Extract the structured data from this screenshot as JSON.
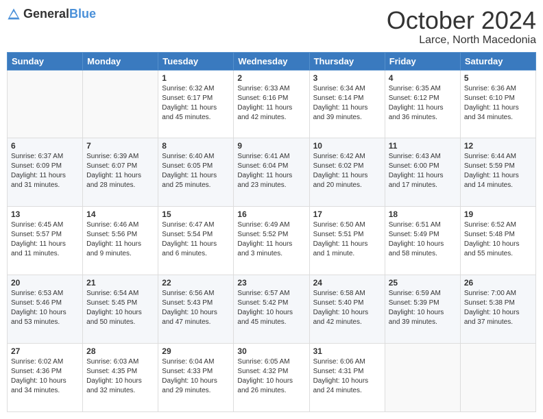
{
  "logo": {
    "general": "General",
    "blue": "Blue"
  },
  "header": {
    "month": "October 2024",
    "location": "Larce, North Macedonia"
  },
  "days_of_week": [
    "Sunday",
    "Monday",
    "Tuesday",
    "Wednesday",
    "Thursday",
    "Friday",
    "Saturday"
  ],
  "weeks": [
    [
      {
        "day": "",
        "info": ""
      },
      {
        "day": "",
        "info": ""
      },
      {
        "day": "1",
        "info": "Sunrise: 6:32 AM\nSunset: 6:17 PM\nDaylight: 11 hours and 45 minutes."
      },
      {
        "day": "2",
        "info": "Sunrise: 6:33 AM\nSunset: 6:16 PM\nDaylight: 11 hours and 42 minutes."
      },
      {
        "day": "3",
        "info": "Sunrise: 6:34 AM\nSunset: 6:14 PM\nDaylight: 11 hours and 39 minutes."
      },
      {
        "day": "4",
        "info": "Sunrise: 6:35 AM\nSunset: 6:12 PM\nDaylight: 11 hours and 36 minutes."
      },
      {
        "day": "5",
        "info": "Sunrise: 6:36 AM\nSunset: 6:10 PM\nDaylight: 11 hours and 34 minutes."
      }
    ],
    [
      {
        "day": "6",
        "info": "Sunrise: 6:37 AM\nSunset: 6:09 PM\nDaylight: 11 hours and 31 minutes."
      },
      {
        "day": "7",
        "info": "Sunrise: 6:39 AM\nSunset: 6:07 PM\nDaylight: 11 hours and 28 minutes."
      },
      {
        "day": "8",
        "info": "Sunrise: 6:40 AM\nSunset: 6:05 PM\nDaylight: 11 hours and 25 minutes."
      },
      {
        "day": "9",
        "info": "Sunrise: 6:41 AM\nSunset: 6:04 PM\nDaylight: 11 hours and 23 minutes."
      },
      {
        "day": "10",
        "info": "Sunrise: 6:42 AM\nSunset: 6:02 PM\nDaylight: 11 hours and 20 minutes."
      },
      {
        "day": "11",
        "info": "Sunrise: 6:43 AM\nSunset: 6:00 PM\nDaylight: 11 hours and 17 minutes."
      },
      {
        "day": "12",
        "info": "Sunrise: 6:44 AM\nSunset: 5:59 PM\nDaylight: 11 hours and 14 minutes."
      }
    ],
    [
      {
        "day": "13",
        "info": "Sunrise: 6:45 AM\nSunset: 5:57 PM\nDaylight: 11 hours and 11 minutes."
      },
      {
        "day": "14",
        "info": "Sunrise: 6:46 AM\nSunset: 5:56 PM\nDaylight: 11 hours and 9 minutes."
      },
      {
        "day": "15",
        "info": "Sunrise: 6:47 AM\nSunset: 5:54 PM\nDaylight: 11 hours and 6 minutes."
      },
      {
        "day": "16",
        "info": "Sunrise: 6:49 AM\nSunset: 5:52 PM\nDaylight: 11 hours and 3 minutes."
      },
      {
        "day": "17",
        "info": "Sunrise: 6:50 AM\nSunset: 5:51 PM\nDaylight: 11 hours and 1 minute."
      },
      {
        "day": "18",
        "info": "Sunrise: 6:51 AM\nSunset: 5:49 PM\nDaylight: 10 hours and 58 minutes."
      },
      {
        "day": "19",
        "info": "Sunrise: 6:52 AM\nSunset: 5:48 PM\nDaylight: 10 hours and 55 minutes."
      }
    ],
    [
      {
        "day": "20",
        "info": "Sunrise: 6:53 AM\nSunset: 5:46 PM\nDaylight: 10 hours and 53 minutes."
      },
      {
        "day": "21",
        "info": "Sunrise: 6:54 AM\nSunset: 5:45 PM\nDaylight: 10 hours and 50 minutes."
      },
      {
        "day": "22",
        "info": "Sunrise: 6:56 AM\nSunset: 5:43 PM\nDaylight: 10 hours and 47 minutes."
      },
      {
        "day": "23",
        "info": "Sunrise: 6:57 AM\nSunset: 5:42 PM\nDaylight: 10 hours and 45 minutes."
      },
      {
        "day": "24",
        "info": "Sunrise: 6:58 AM\nSunset: 5:40 PM\nDaylight: 10 hours and 42 minutes."
      },
      {
        "day": "25",
        "info": "Sunrise: 6:59 AM\nSunset: 5:39 PM\nDaylight: 10 hours and 39 minutes."
      },
      {
        "day": "26",
        "info": "Sunrise: 7:00 AM\nSunset: 5:38 PM\nDaylight: 10 hours and 37 minutes."
      }
    ],
    [
      {
        "day": "27",
        "info": "Sunrise: 6:02 AM\nSunset: 4:36 PM\nDaylight: 10 hours and 34 minutes."
      },
      {
        "day": "28",
        "info": "Sunrise: 6:03 AM\nSunset: 4:35 PM\nDaylight: 10 hours and 32 minutes."
      },
      {
        "day": "29",
        "info": "Sunrise: 6:04 AM\nSunset: 4:33 PM\nDaylight: 10 hours and 29 minutes."
      },
      {
        "day": "30",
        "info": "Sunrise: 6:05 AM\nSunset: 4:32 PM\nDaylight: 10 hours and 26 minutes."
      },
      {
        "day": "31",
        "info": "Sunrise: 6:06 AM\nSunset: 4:31 PM\nDaylight: 10 hours and 24 minutes."
      },
      {
        "day": "",
        "info": ""
      },
      {
        "day": "",
        "info": ""
      }
    ]
  ]
}
